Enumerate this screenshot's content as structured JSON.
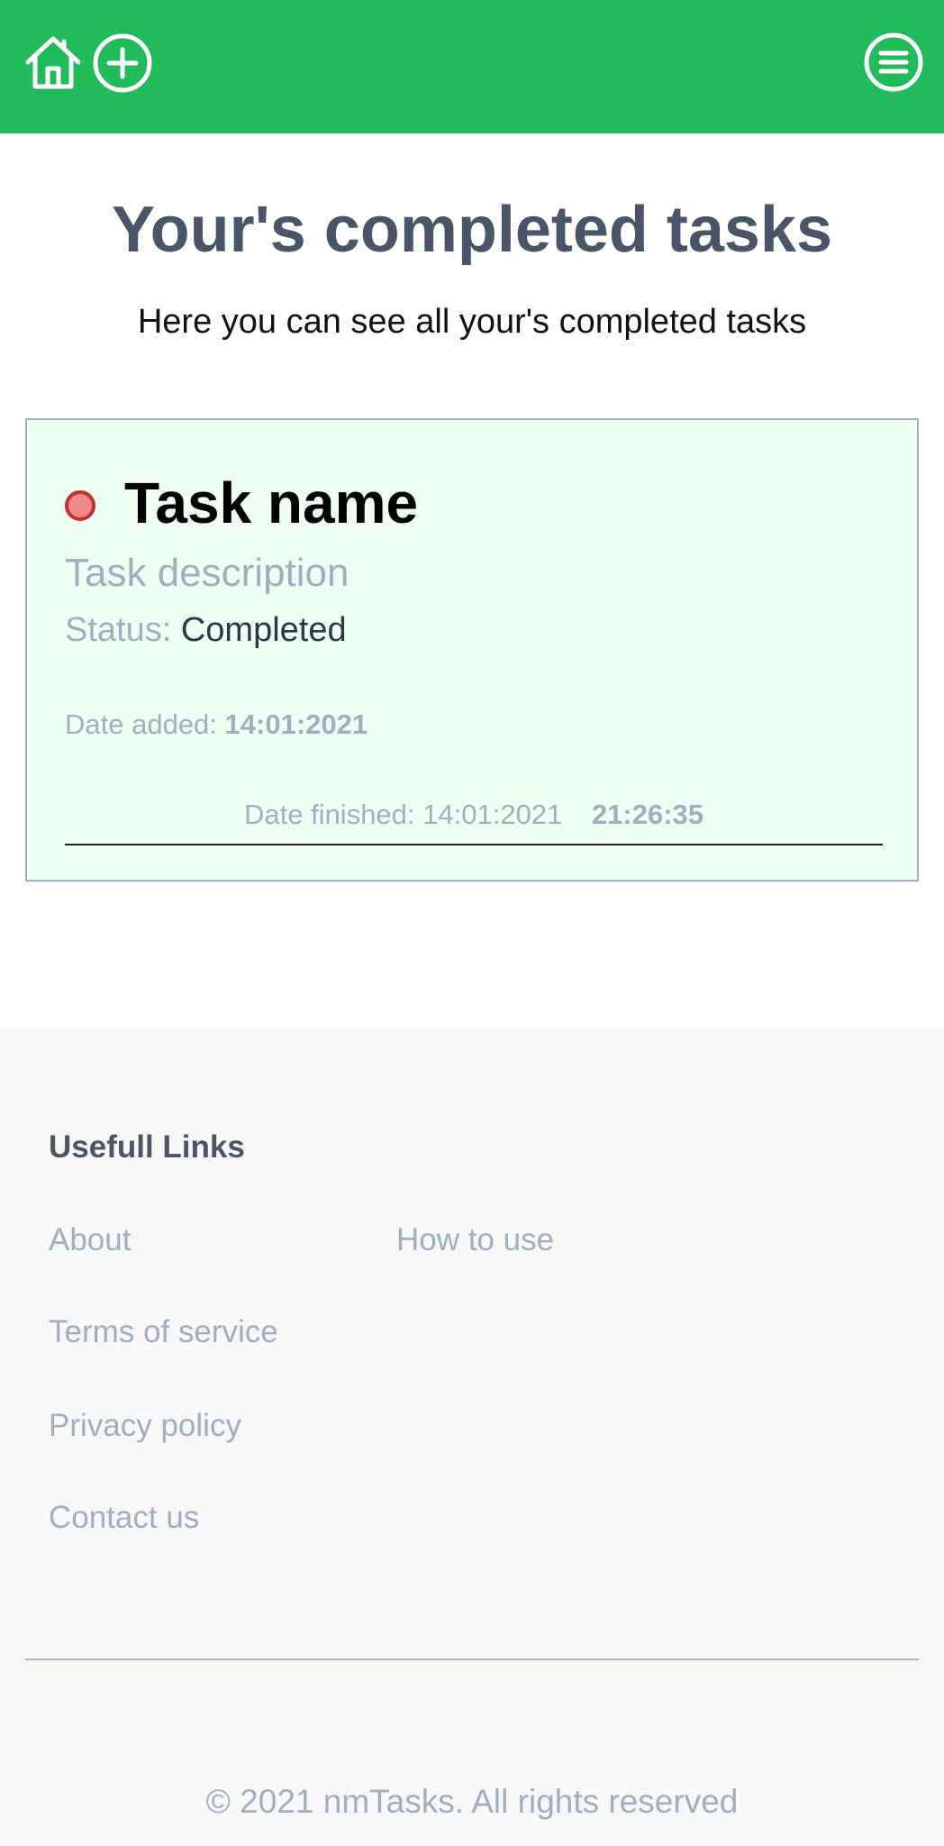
{
  "header": {
    "background_color": "#22bb5b",
    "home_icon": "home-icon",
    "add_icon": "plus-circle-icon",
    "menu_icon": "menu-circle-icon"
  },
  "main": {
    "title": "Your's completed tasks",
    "subtitle": "Here you can see all your's completed tasks"
  },
  "task": {
    "name": "Task name",
    "description": "Task description",
    "status_label": "Status:",
    "status_value": "Completed",
    "date_added_label": "Date added:",
    "date_added_value": "14:01:2021",
    "date_finished_label": "Date finished:",
    "date_finished_date": "14:01:2021",
    "date_finished_time": "21:26:35",
    "card_background": "#f0fff4",
    "priority_color": "#f08a8a"
  },
  "footer": {
    "heading": "Usefull Links",
    "links": {
      "about": "About",
      "how_to_use": "How to use",
      "terms": "Terms of service",
      "privacy": "Privacy policy",
      "contact": "Contact us"
    },
    "copyright": "© 2021 nmTasks. All rights reserved"
  }
}
